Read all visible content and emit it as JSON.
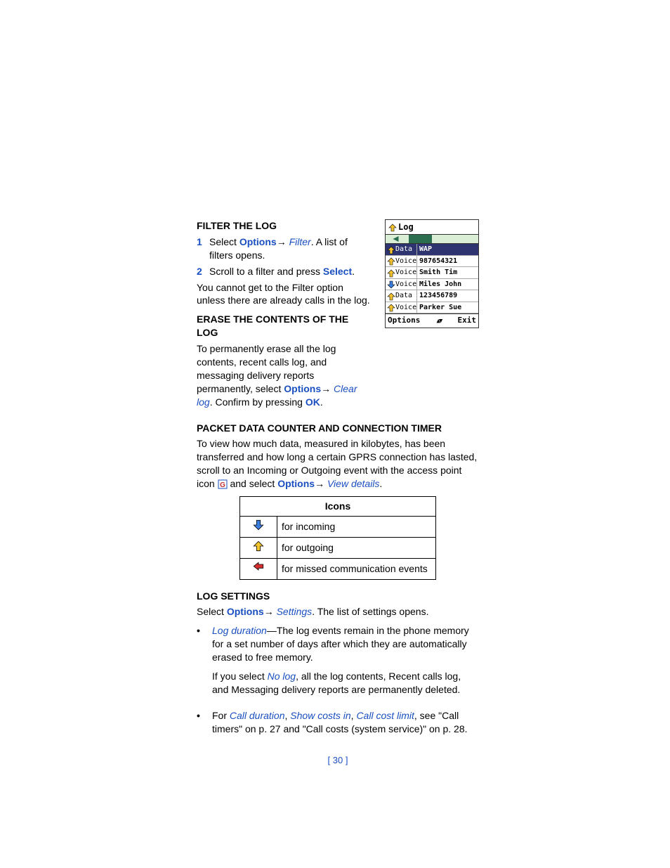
{
  "section_filter_heading": "FILTER THE LOG",
  "step1_num": "1",
  "step1_pre": "Select ",
  "step1_options": "Options",
  "step1_arrow": "→",
  "step1_filter": " Filter",
  "step1_post": ". A list of filters opens.",
  "step2_num": "2",
  "step2_pre": "Scroll to a filter and press ",
  "step2_select": "Select",
  "step2_post": ".",
  "filter_note": "You cannot get to the Filter option unless there are already calls in the log.",
  "section_erase_heading": "ERASE THE CONTENTS OF THE LOG",
  "erase_pre": "To permanently erase all the log contents, recent calls log, and messaging delivery reports permanently, select ",
  "erase_options": "Options",
  "erase_arrow": "→",
  "erase_clearlog": " Clear log",
  "erase_mid": ". Confirm by pressing ",
  "erase_ok": "OK",
  "erase_end": ".",
  "section_packet_heading": "PACKET DATA COUNTER AND CONNECTION TIMER",
  "packet_pre": "To view how much data, measured in kilobytes, has been transferred and how long a certain GPRS connection has lasted, scroll to an Incoming or Outgoing event with the access point icon ",
  "packet_mid": " and select ",
  "packet_options": "Options",
  "packet_arrow": "→",
  "packet_view": " View details",
  "packet_end": ".",
  "icons_header": "Icons",
  "icon_row1": "for incoming",
  "icon_row2": "for outgoing",
  "icon_row3": "for missed communication events",
  "section_log_settings_heading": "LOG SETTINGS",
  "logset_pre": "Select ",
  "logset_options": "Options",
  "logset_arrow": "→",
  "logset_settings": " Settings",
  "logset_post": ". The list of settings opens.",
  "bullet_logdur_label": "Log duration",
  "bullet_logdur_text": "—The log events remain in the phone memory for a set number of days after which they are automatically erased to free memory.",
  "bullet_nolog_pre": "If you select ",
  "bullet_nolog_label": "No log",
  "bullet_nolog_post": ", all the log contents, Recent calls log, and Messaging delivery reports are permanently deleted.",
  "bullet_for": "For ",
  "bullet_calldur": "Call duration",
  "bullet_comma1": ", ",
  "bullet_showcosts": "Show costs in",
  "bullet_comma2": ", ",
  "bullet_ccl": "Call cost limit",
  "bullet_tail": ", see \"Call timers\" on p. 27 and \"Call costs (system service)\" on p. 28.",
  "page_number": "[ 30 ]",
  "device": {
    "title": "Log",
    "rows": [
      {
        "type": "Data",
        "name": "WAP",
        "selected": true,
        "dir": "out"
      },
      {
        "type": "Voice",
        "name": "987654321",
        "selected": false,
        "dir": "out"
      },
      {
        "type": "Voice",
        "name": "Smith Tim",
        "selected": false,
        "dir": "out"
      },
      {
        "type": "Voice",
        "name": "Miles John",
        "selected": false,
        "dir": "in"
      },
      {
        "type": "Data",
        "name": "123456789",
        "selected": false,
        "dir": "out"
      },
      {
        "type": "Voice",
        "name": "Parker Sue",
        "selected": false,
        "dir": "out"
      }
    ],
    "sk_left": "Options",
    "sk_right": "Exit"
  }
}
